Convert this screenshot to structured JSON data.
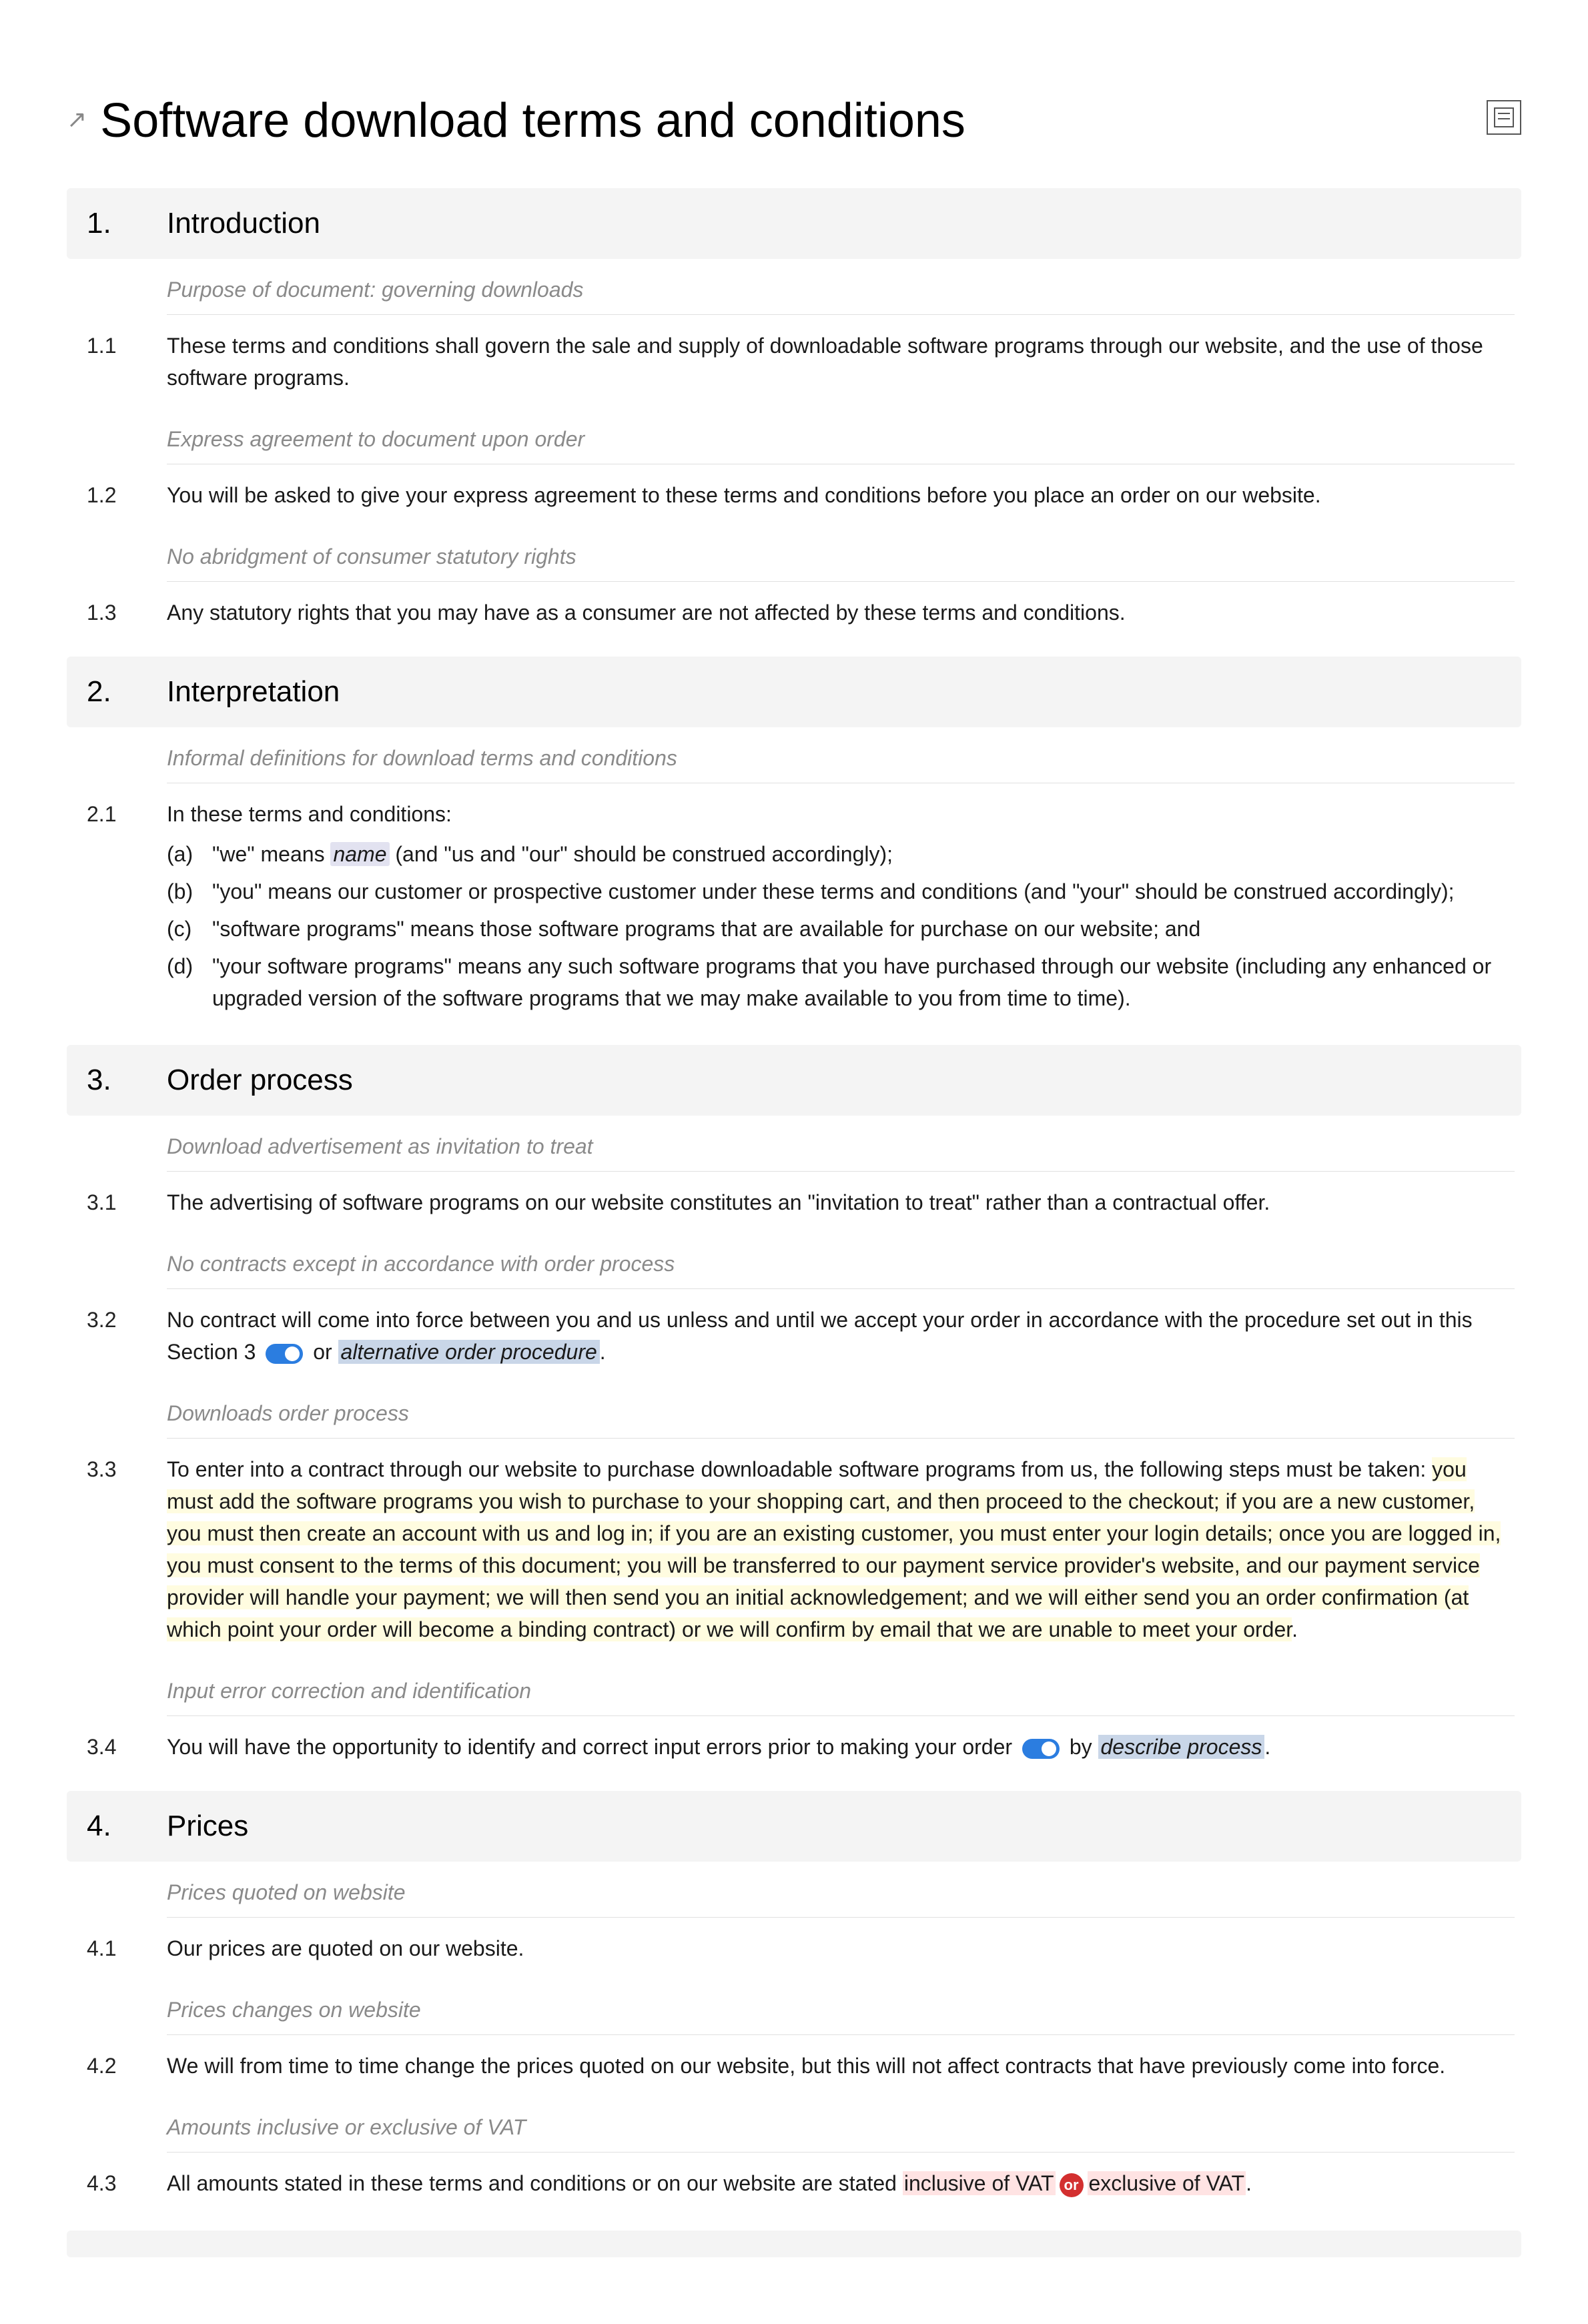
{
  "title": "Software download terms and conditions",
  "sections": [
    {
      "num": "1.",
      "title": "Introduction",
      "items": [
        {
          "type": "note",
          "text": "Purpose of document: governing downloads"
        },
        {
          "type": "clause",
          "num": "1.1",
          "text": "These terms and conditions shall govern the sale and supply of downloadable software programs through our website, and the use of those software programs."
        },
        {
          "type": "note",
          "text": "Express agreement to document upon order"
        },
        {
          "type": "clause",
          "num": "1.2",
          "text": "You will be asked to give your express agreement to these terms and conditions before you place an order on our website."
        },
        {
          "type": "note",
          "text": "No abridgment of consumer statutory rights"
        },
        {
          "type": "clause",
          "num": "1.3",
          "text": "Any statutory rights that you may have as a consumer are not affected by these terms and conditions."
        }
      ]
    },
    {
      "num": "2.",
      "title": "Interpretation",
      "items": [
        {
          "type": "note",
          "text": "Informal definitions for download terms and conditions"
        },
        {
          "type": "clause-with-subs",
          "num": "2.1",
          "lead": "In these terms and conditions:",
          "subs": [
            {
              "label": "(a)",
              "pre": "\"we\" means ",
              "var": "name",
              "post": " (and \"us and \"our\" should be construed accordingly);"
            },
            {
              "label": "(b)",
              "text": "\"you\" means our customer or prospective customer under these terms and conditions (and \"your\" should be construed accordingly);"
            },
            {
              "label": "(c)",
              "text": "\"software programs\" means those software programs that are available for purchase on our website; and"
            },
            {
              "label": "(d)",
              "text": "\"your software programs\" means any such software programs that you have purchased through our website (including any enhanced or upgraded version of the software programs that we may make available to you from time to time)."
            }
          ]
        }
      ]
    },
    {
      "num": "3.",
      "title": "Order process",
      "items": [
        {
          "type": "note",
          "text": "Download advertisement as invitation to treat"
        },
        {
          "type": "clause",
          "num": "3.1",
          "text": "The advertising of software programs on our website constitutes an \"invitation to treat\" rather than a contractual offer."
        },
        {
          "type": "note",
          "text": "No contracts except in accordance with order process"
        },
        {
          "type": "clause-32",
          "num": "3.2",
          "pre": "No contract will come into force between you and us unless and until we accept your order in accordance with the procedure set out in this Section 3 ",
          "toggle": true,
          "mid": " or ",
          "alt": "alternative order procedure",
          "post": "."
        },
        {
          "type": "note",
          "text": "Downloads order process"
        },
        {
          "type": "clause-33",
          "num": "3.3",
          "pre": "To enter into a contract through our website to purchase downloadable software programs from us, the following steps must be taken: ",
          "hl": "you must add the software programs you wish to purchase to your shopping cart, and then proceed to the checkout; if you are a new customer, you must then create an account with us and log in; if you are an existing customer, you must enter your login details; once you are logged in, you must consent to the terms of this document; you will be transferred to our payment service provider's website, and our payment service provider will handle your payment; we will then send you an initial acknowledgement; and we will either send you an order confirmation (at which point your order will become a binding contract) or we will confirm by email that we are unable to meet your order",
          "post": "."
        },
        {
          "type": "note",
          "text": "Input error correction and identification"
        },
        {
          "type": "clause-34",
          "num": "3.4",
          "pre": "You will have the opportunity to identify and correct input errors prior to making your order ",
          "toggle": true,
          "mid": " by ",
          "alt": "describe process",
          "post": "."
        }
      ]
    },
    {
      "num": "4.",
      "title": "Prices",
      "items": [
        {
          "type": "note",
          "text": "Prices quoted on website"
        },
        {
          "type": "clause",
          "num": "4.1",
          "text": "Our prices are quoted on our website."
        },
        {
          "type": "note",
          "text": "Prices changes on website"
        },
        {
          "type": "clause",
          "num": "4.2",
          "text": "We will from time to time change the prices quoted on our website, but this will not affect contracts that have previously come into force."
        },
        {
          "type": "note",
          "text": "Amounts inclusive or exclusive of VAT"
        },
        {
          "type": "clause-43",
          "num": "4.3",
          "pre": "All amounts stated in these terms and conditions or on our website are stated ",
          "opt1": "inclusive of VAT",
          "or": "or",
          "opt2": "exclusive of VAT",
          "post": "."
        }
      ]
    }
  ]
}
